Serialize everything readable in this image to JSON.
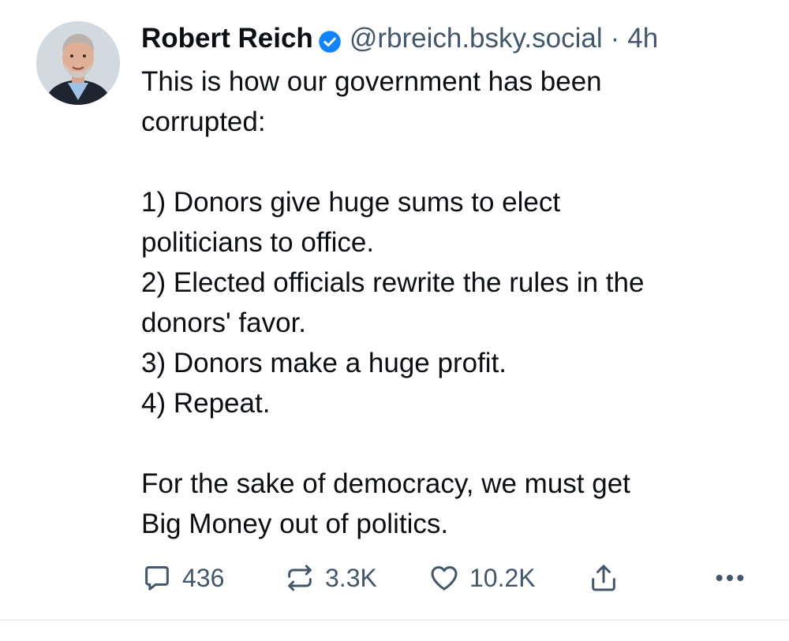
{
  "post": {
    "author": {
      "display_name": "Robert Reich",
      "handle": "@rbreich.bsky.social",
      "verified": true
    },
    "separator": "·",
    "timestamp": "4h",
    "text": "This is how our government has been\ncorrupted:\n\n1) Donors give huge sums to elect\npoliticians to office.\n2) Elected officials rewrite the rules in the\ndonors' favor.\n3) Donors make a huge profit.\n4) Repeat.\n\nFor the sake of democracy, we must get\nBig Money out of politics.",
    "actions": {
      "reply": {
        "icon": "reply-icon",
        "count": "436"
      },
      "repost": {
        "icon": "repost-icon",
        "count": "3.3K"
      },
      "like": {
        "icon": "heart-icon",
        "count": "10.2K"
      },
      "share": {
        "icon": "share-icon"
      },
      "more": {
        "icon": "more-icon"
      }
    }
  },
  "colors": {
    "text": "#0b0f14",
    "secondary": "#42576c",
    "verified_badge": "#1083fe",
    "divider": "#e5e8eb"
  }
}
